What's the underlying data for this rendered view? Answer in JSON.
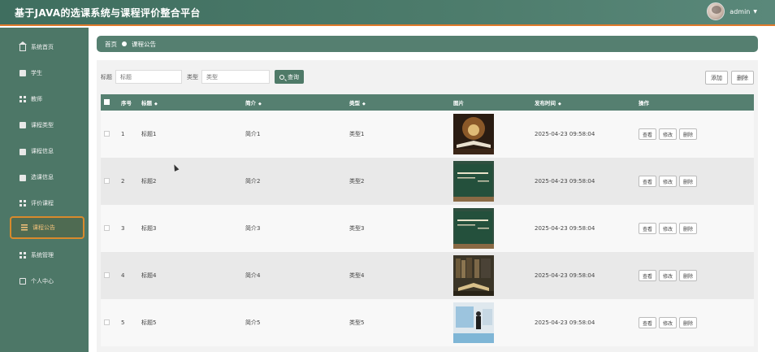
{
  "app": {
    "title": "基于JAVA的选课系统与课程评价整合平台"
  },
  "user": {
    "name": "admin"
  },
  "sidebar": {
    "items": [
      {
        "label": "系统首页",
        "icon": "home-icon"
      },
      {
        "label": "学生",
        "icon": "doc-icon"
      },
      {
        "label": "教师",
        "icon": "grid-icon"
      },
      {
        "label": "课程类型",
        "icon": "doc-icon"
      },
      {
        "label": "课程信息",
        "icon": "monitor-icon"
      },
      {
        "label": "选课信息",
        "icon": "bag-icon"
      },
      {
        "label": "评价课程",
        "icon": "grid-icon"
      },
      {
        "label": "课程公告",
        "icon": "list-icon"
      },
      {
        "label": "系统管理",
        "icon": "grid-icon"
      },
      {
        "label": "个人中心",
        "icon": "box-icon"
      }
    ]
  },
  "breadcrumb": {
    "home": "首页",
    "current": "课程公告"
  },
  "search": {
    "title_label": "标题",
    "title_placeholder": "标题",
    "type_label": "类型",
    "type_placeholder": "类型",
    "query_label": "查询"
  },
  "toolbar": {
    "add_label": "添加",
    "delete_label": "删除"
  },
  "table": {
    "headers": [
      "序号",
      "标题",
      "简介",
      "类型",
      "图片",
      "发布时间",
      "操作"
    ],
    "rows": [
      {
        "index": "1",
        "title": "标题1",
        "intro": "简介1",
        "type": "类型1",
        "image": "book-glow",
        "time": "2025-04-23 09:58:04"
      },
      {
        "index": "2",
        "title": "标题2",
        "intro": "简介2",
        "type": "类型2",
        "image": "chalkboard",
        "time": "2025-04-23 09:58:04"
      },
      {
        "index": "3",
        "title": "标题3",
        "intro": "简介3",
        "type": "类型3",
        "image": "chalkboard",
        "time": "2025-04-23 09:58:04"
      },
      {
        "index": "4",
        "title": "标题4",
        "intro": "简介4",
        "type": "类型4",
        "image": "library-books",
        "time": "2025-04-23 09:58:04"
      },
      {
        "index": "5",
        "title": "标题5",
        "intro": "简介5",
        "type": "类型5",
        "image": "presenter",
        "time": "2025-04-23 09:58:04"
      }
    ],
    "actions": {
      "view": "查看",
      "edit": "修改",
      "delete": "删除"
    }
  },
  "colors": {
    "primary": "#557f70",
    "sidebar": "#4d7767",
    "accent": "#d98a2c"
  }
}
